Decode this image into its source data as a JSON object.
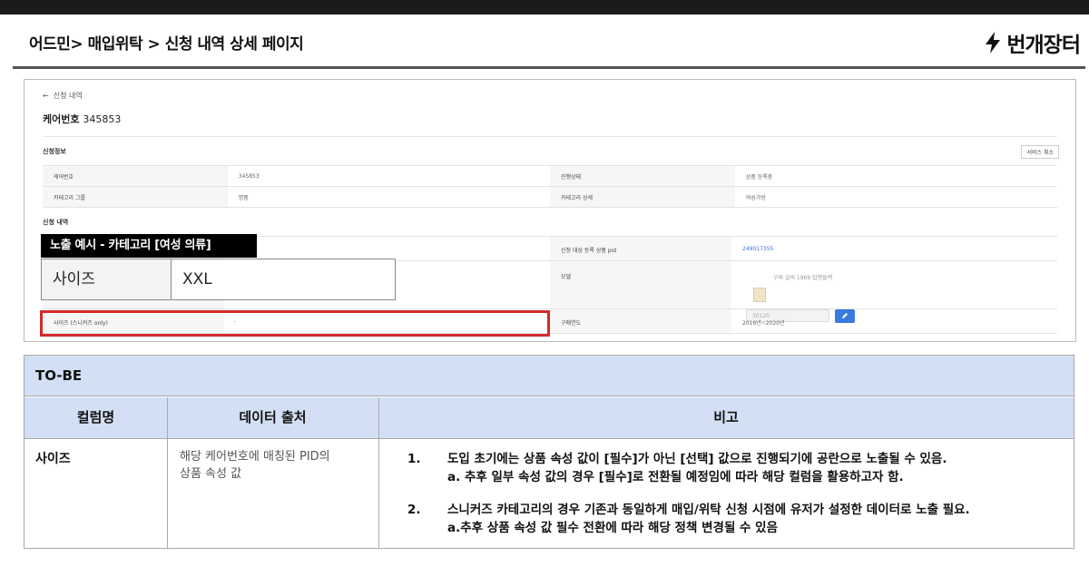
{
  "header": {
    "title": "어드민> 매입위탁 > 신청 내역 상세 페이지",
    "logo_text": "번개장터"
  },
  "admin": {
    "back_label": "신청 내역",
    "care_label": "케어번호",
    "care_number": "345853",
    "section_info": "신청정보",
    "service_cancel": "서비스 취소",
    "info_rows": [
      {
        "k1": "케어번호",
        "v1": "345853",
        "k2": "진행상태",
        "v2": "상품 등록중"
      },
      {
        "k1": "카테고리 그룹",
        "v1": "명품",
        "k2": "카테고리 상세",
        "v2": "여성가방"
      }
    ],
    "section_detail": "신청 내역",
    "pid_label": "신청 대상 등록 상품 pid",
    "pid_value": "249017355",
    "model_label": "모델",
    "model_text": "구찌 실비 1969 탑핸들백",
    "model_input": "30120",
    "size_label": "사이즈 (스니커즈 only)",
    "size_value": "-",
    "year_label": "구매연도",
    "year_value": "2016년~2020년"
  },
  "example": {
    "banner": "노출 예시 - 카테고리 [여성 의류]",
    "key": "사이즈",
    "value": "XXL"
  },
  "tobe": {
    "title": "TO-BE",
    "headers": [
      "컬럼명",
      "데이터 출처",
      "비고"
    ],
    "row": {
      "column": "사이즈",
      "source_line1": "해당 케어번호에 매칭된 PID의",
      "source_line2": "상품 속성 값",
      "notes": [
        {
          "num": "1.",
          "line1": "도입 초기에는 상품 속성 값이 [필수]가 아닌 [선택] 값으로 진행되기에 공란으로 노출될 수 있음.",
          "line2": "a. 추후 일부 속성 값의 경우 [필수]로 전환될 예정임에 따라 해당 컬럼을 활용하고자 함."
        },
        {
          "num": "2.",
          "line1": "스니커즈 카테고리의 경우 기존과 동일하게 매입/위탁 신청 시점에 유저가 설정한 데이터로 노출 필요.",
          "line2": "a.추후 상품 속성 값 필수 전환에 따라 해당 정책 변경될 수 있음"
        }
      ]
    }
  }
}
